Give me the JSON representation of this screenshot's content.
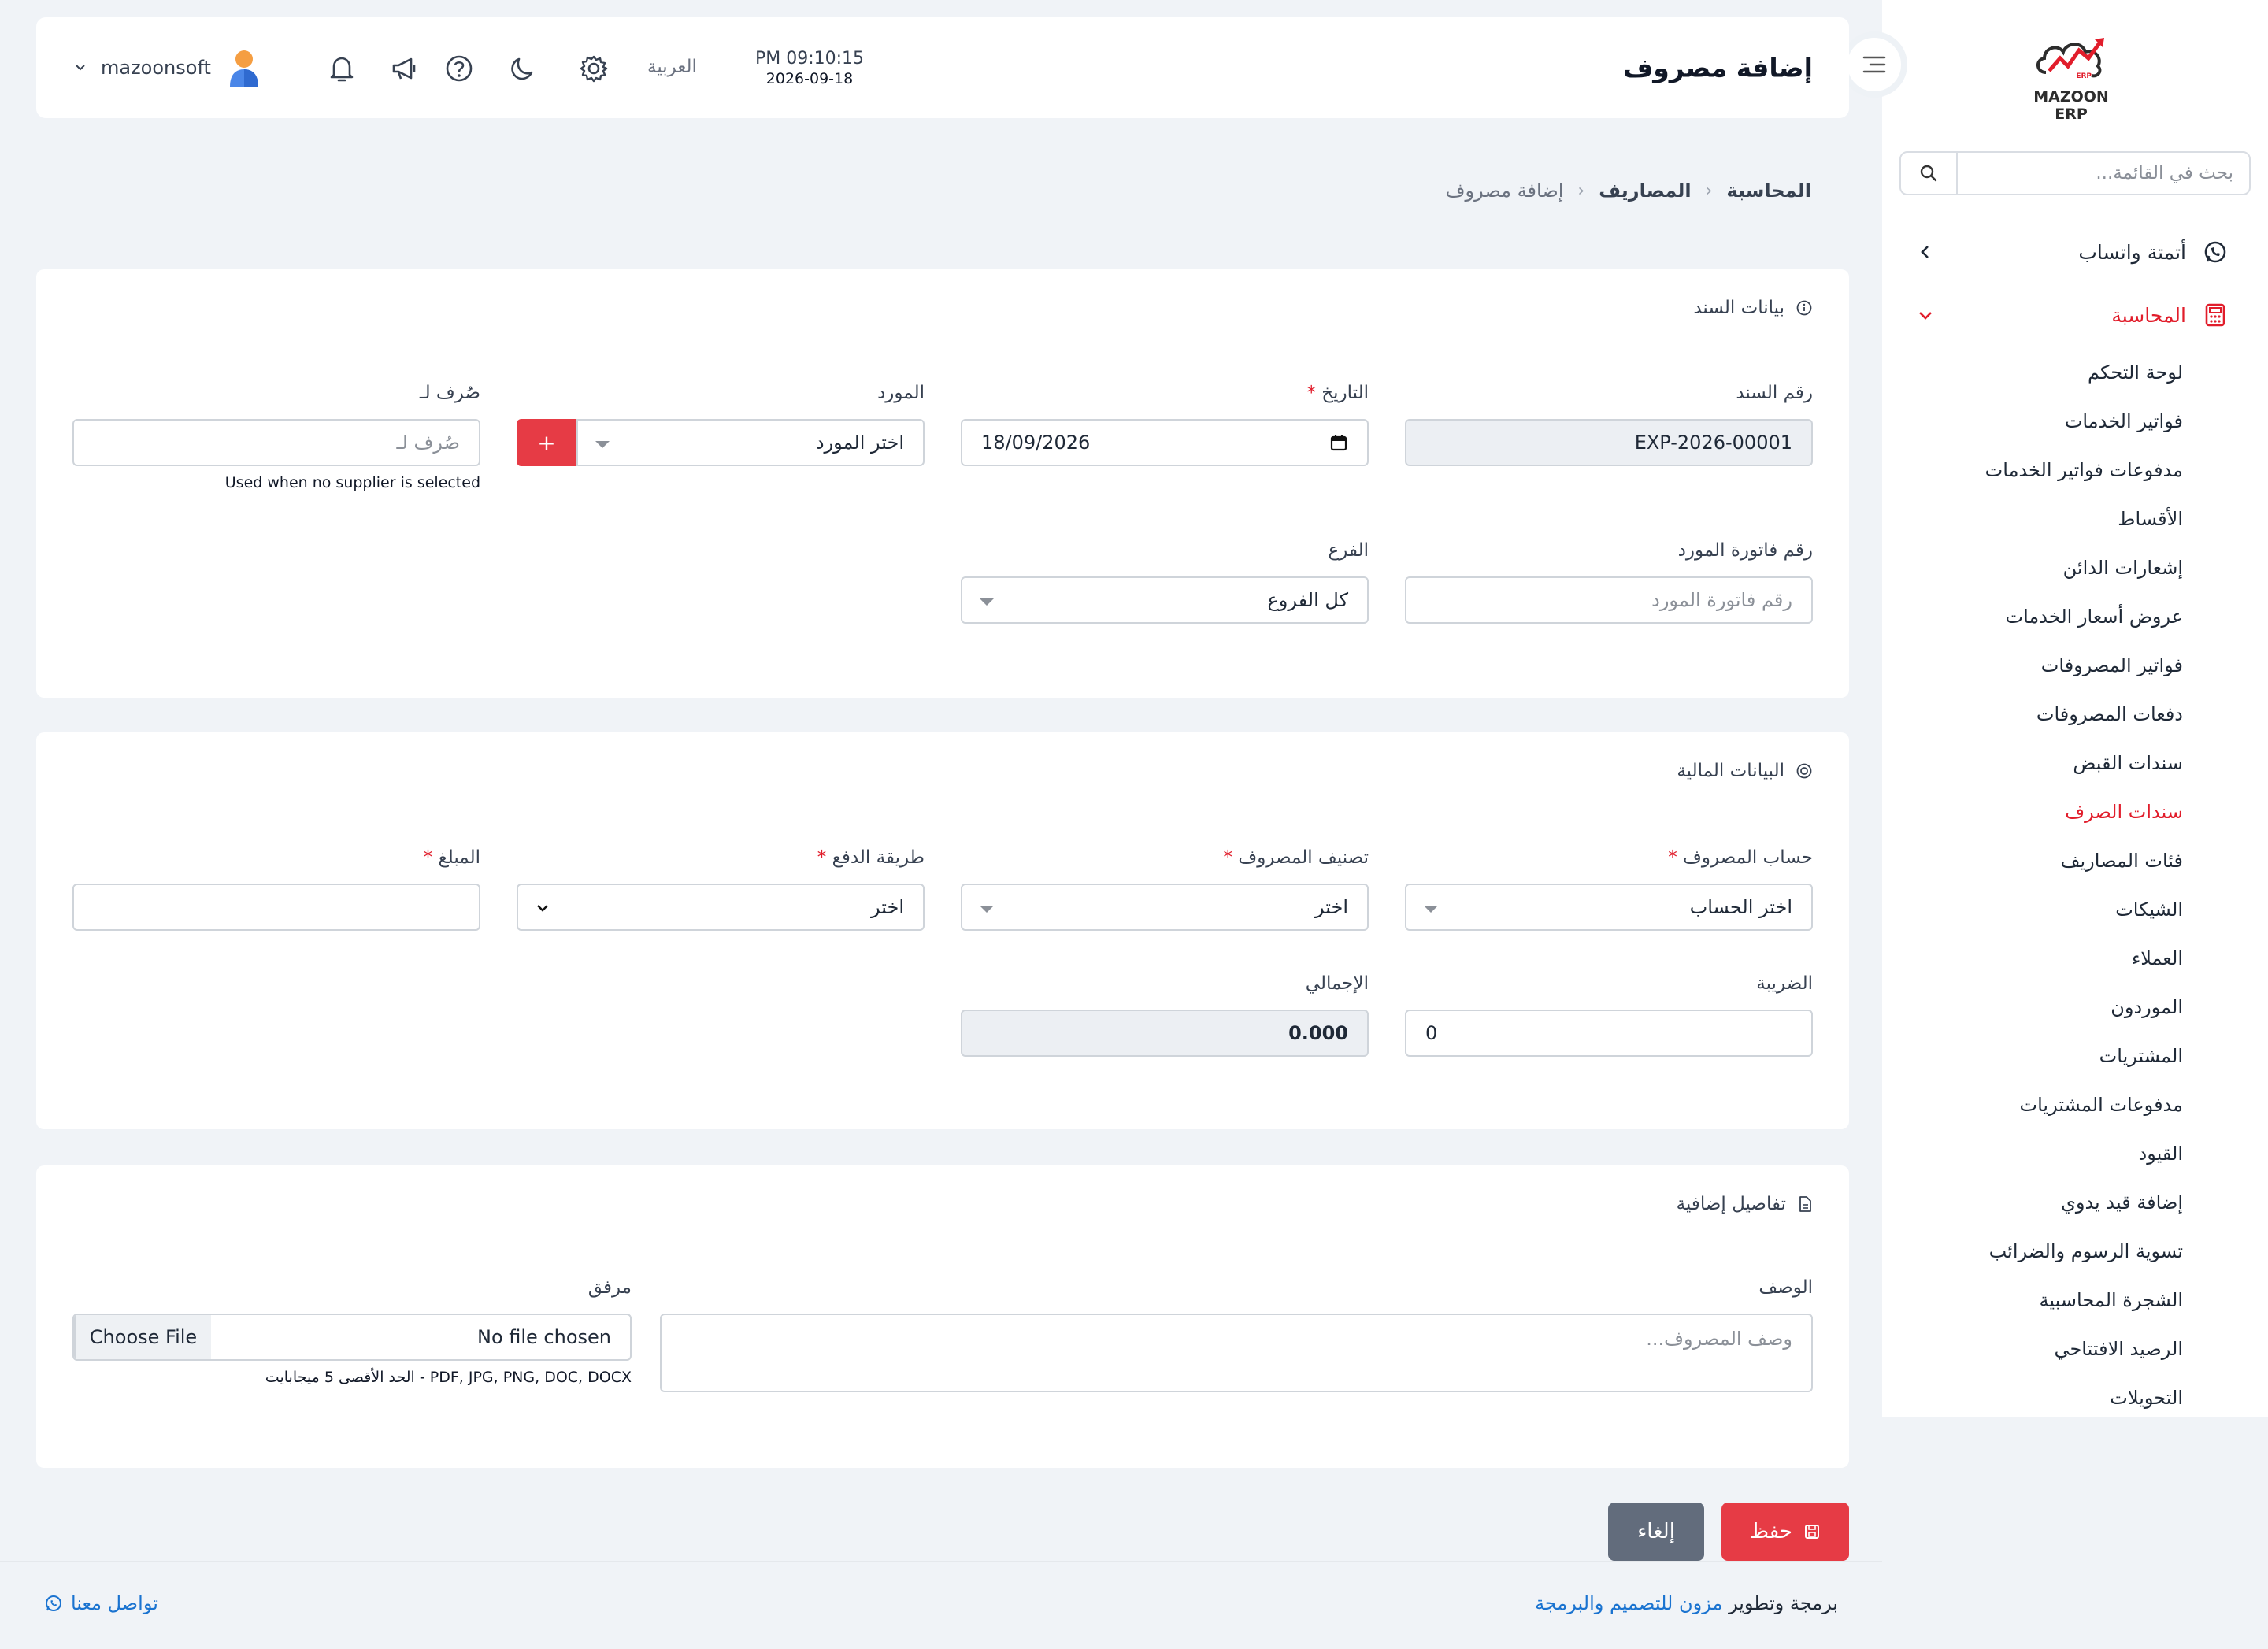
{
  "app": {
    "logo_text": "MAZOON ERP",
    "logo_sub": "ERP",
    "page_title": "إضافة مصروف"
  },
  "topbar": {
    "time": "PM 09:10:15",
    "date": "2026-09-18",
    "language": "العربية",
    "username": "mazoonsoft"
  },
  "sidebar": {
    "search_placeholder": "بحث في القائمة...",
    "groups": [
      {
        "label": "أتمتة واتساب",
        "icon": "whatsapp-icon",
        "expanded": false
      },
      {
        "label": "المحاسبة",
        "icon": "calculator-icon",
        "expanded": true,
        "color": "#e11d2b"
      }
    ],
    "items": [
      {
        "label": "لوحة التحكم"
      },
      {
        "label": "فواتير الخدمات"
      },
      {
        "label": "مدفوعات فواتير الخدمات"
      },
      {
        "label": "الأقساط"
      },
      {
        "label": "إشعارات الدائن"
      },
      {
        "label": "عروض أسعار الخدمات"
      },
      {
        "label": "فواتير المصروفات"
      },
      {
        "label": "دفعات المصروفات"
      },
      {
        "label": "سندات القبض"
      },
      {
        "label": "سندات الصرف",
        "active": true
      },
      {
        "label": "فئات المصاريف"
      },
      {
        "label": "الشيكات"
      },
      {
        "label": "العملاء"
      },
      {
        "label": "الموردون"
      },
      {
        "label": "المشتريات"
      },
      {
        "label": "مدفوعات المشتريات"
      },
      {
        "label": "القيود"
      },
      {
        "label": "إضافة قيد يدوي"
      },
      {
        "label": "تسوية الرسوم والضرائب"
      },
      {
        "label": "الشجرة المحاسبية"
      },
      {
        "label": "الرصيد الافتتاحي"
      },
      {
        "label": "التحويلات"
      }
    ]
  },
  "breadcrumb": {
    "root": "المحاسبة",
    "parent": "المصاريف",
    "current": "إضافة مصروف"
  },
  "voucher": {
    "title": "بيانات السند",
    "voucher_no": {
      "label": "رقم السند",
      "value": "EXP-2026-00001"
    },
    "date": {
      "label": "التاريخ",
      "value": "18/09/2026"
    },
    "supplier": {
      "label": "المورد",
      "value": "اختر المورد",
      "add": "+"
    },
    "paid_to": {
      "label": "صُرف لـ",
      "placeholder": "صُرف لـ",
      "hint": "Used when no supplier is selected"
    },
    "supplier_invoice": {
      "label": "رقم فاتورة المورد",
      "placeholder": "رقم فاتورة المورد"
    },
    "branch": {
      "label": "الفرع",
      "value": "كل الفروع"
    }
  },
  "financial": {
    "title": "البيانات المالية",
    "expense_account": {
      "label": "حساب المصروف",
      "value": "اختر الحساب"
    },
    "expense_category": {
      "label": "تصنيف المصروف",
      "value": "اختر"
    },
    "payment_method": {
      "label": "طريقة الدفع",
      "value": "اختر"
    },
    "amount": {
      "label": "المبلغ",
      "value": ""
    },
    "tax": {
      "label": "الضريبة",
      "value": "0"
    },
    "total": {
      "label": "الإجمالي",
      "value": "0.000"
    }
  },
  "extra": {
    "title": "تفاصيل إضافية",
    "description": {
      "label": "الوصف",
      "placeholder": "وصف المصروف..."
    },
    "attachment": {
      "label": "مرفق",
      "button": "Choose File",
      "status": "No file chosen",
      "hint": "PDF, JPG, PNG, DOC, DOCX - الحد الأقصى 5 ميجابايت"
    }
  },
  "actions": {
    "save": "حفظ",
    "cancel": "إلغاء"
  },
  "footer": {
    "credit_prefix": "برمجة وتطوير",
    "credit_link": "مزون للتصميم والبرمجة",
    "contact": "تواصل معنا"
  },
  "colors": {
    "accent": "#e63b45",
    "active_menu": "#e11d2b",
    "cancel_button": "#626c7c",
    "link": "#1a73d0"
  }
}
